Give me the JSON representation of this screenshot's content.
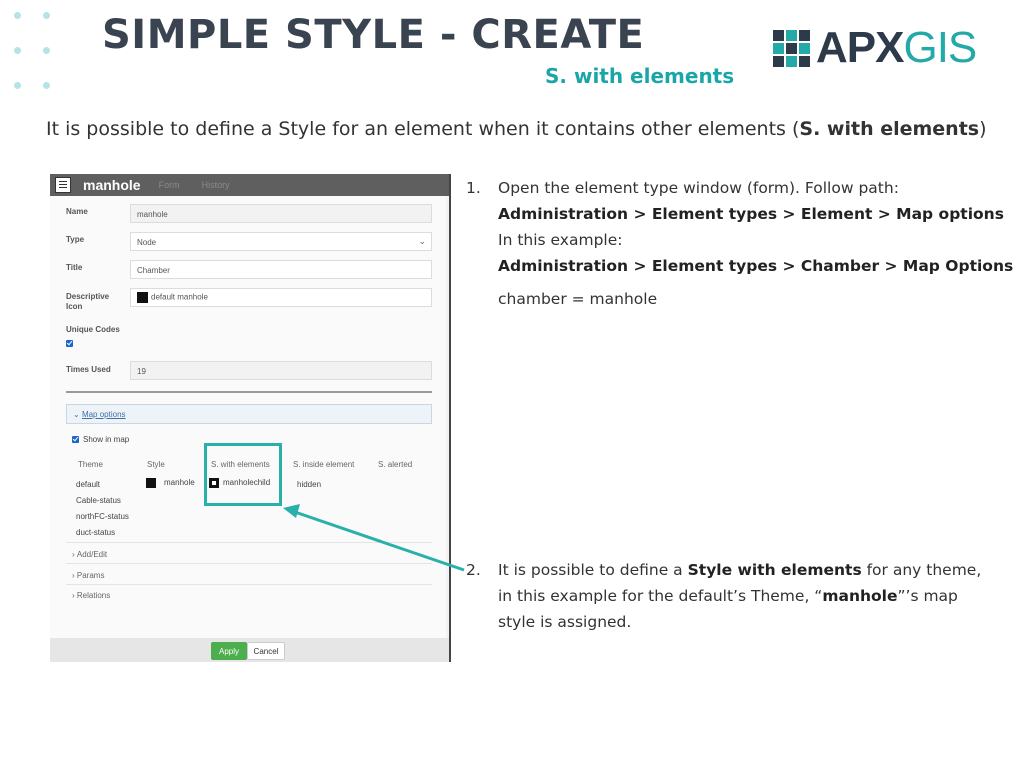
{
  "slide": {
    "title": "SIMPLE STYLE - CREATE",
    "subtitle": "S. with elements",
    "intro_text": "It is possible to define a Style for an element when it contains other elements  (",
    "intro_bold": "S. with elements",
    "intro_end": ")"
  },
  "logo": {
    "part1": "APX",
    "part2": "GIS"
  },
  "window": {
    "title": "manhole",
    "tabs": [
      "Form",
      "History"
    ],
    "fields": {
      "name_label": "Name",
      "name_value": "manhole",
      "type_label": "Type",
      "type_value": "Node",
      "title_label": "Title",
      "title_value": "Chamber",
      "icon_label_1": "Descriptive",
      "icon_label_2": "Icon",
      "icon_value": "default manhole",
      "unique_label": "Unique Codes",
      "times_label": "Times Used",
      "times_value": "19"
    },
    "map_options": {
      "title": "Map options",
      "show_in_map": "Show in map",
      "columns": [
        "Theme",
        "Style",
        "S. with elements",
        "S. inside element",
        "S. alerted"
      ],
      "rows": [
        {
          "theme": "default",
          "style": "manhole",
          "with_elements": "manholechild",
          "inside": "hidden"
        },
        {
          "theme": "Cable-status"
        },
        {
          "theme": "northFC-status"
        },
        {
          "theme": "duct-status"
        }
      ]
    },
    "accordions": [
      "Add/Edit",
      "Params",
      "Relations"
    ],
    "buttons": {
      "apply": "Apply",
      "cancel": "Cancel"
    }
  },
  "steps": {
    "s1": {
      "num": "1.",
      "line1": "Open the element type window (form). Follow path:",
      "line2": "Administration > Element types > Element > Map options",
      "line3": "In this example:",
      "line4": "Administration > Element types > Chamber > Map Options",
      "line5": "chamber = manhole"
    },
    "s2": {
      "num": "2.",
      "p1": "It is possible to define a ",
      "p1_bold": "Style with elements",
      "p1_end": " for any theme,",
      "line2": "in this example for the default’s Theme, “",
      "line2_bold": "manhole",
      "line2_end": "”’s map",
      "line3": "style is assigned."
    }
  },
  "colors": {
    "accent": "#1aa6a8",
    "title": "#3a4350",
    "apply": "#4cae4c",
    "highlight": "#2ab0aa"
  }
}
